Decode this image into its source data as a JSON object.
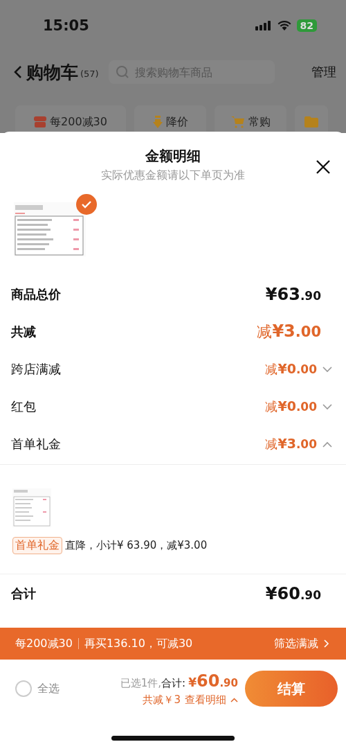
{
  "status_bar": {
    "time": "15:05",
    "battery": "82"
  },
  "nav": {
    "title": "购物车",
    "count": "(57)",
    "search": {
      "placeholder": "搜索购物车商品"
    },
    "manage": "管理"
  },
  "chips": [
    {
      "kind": "promo",
      "label": "每200减30"
    },
    {
      "kind": "price-drop",
      "label": "降价"
    },
    {
      "kind": "frequent",
      "label": "常购"
    },
    {
      "kind": "folder"
    }
  ],
  "sheet": {
    "title": "金额明细",
    "subtitle": "实际优惠金额请以下单页为准",
    "items": [
      {
        "kind": "picture",
        "checked": true
      }
    ],
    "rows": [
      {
        "kind": "total",
        "label": "商品总价",
        "prefix": "",
        "integer": "¥63",
        "decimal": ".90"
      },
      {
        "kind": "discount",
        "label": "共减",
        "prefix": "减",
        "integer": "¥3",
        "decimal": ".00"
      },
      {
        "kind": "sub",
        "label": "跨店满减",
        "prefix": "减",
        "integer": "¥0",
        "decimal": ".00",
        "expanded": false
      },
      {
        "kind": "sub",
        "label": "红包",
        "prefix": "减",
        "integer": "¥0",
        "decimal": ".00",
        "expanded": false
      },
      {
        "kind": "sub",
        "label": "首单礼金",
        "prefix": "减",
        "integer": "¥3",
        "decimal": ".00",
        "expanded": true
      }
    ],
    "detail": {
      "kind": "picture",
      "tag": "首单礼金",
      "text": "直降，小计¥ 63.90，减¥3.00"
    },
    "sum": {
      "label": "合计",
      "integer": "¥60",
      "decimal": ".90"
    }
  },
  "promo_bar": {
    "rule": "每200减30",
    "hint": "再买136.10，可减30",
    "link": "筛选满减"
  },
  "footer": {
    "select_all": {
      "label": "全选",
      "checked": false
    },
    "selected": "已选1件,",
    "total_label": "合计:",
    "currency": "¥",
    "integer": "60",
    "decimal": ".90",
    "saved": "共减￥3",
    "details": "查看明细",
    "checkout": "结算"
  }
}
